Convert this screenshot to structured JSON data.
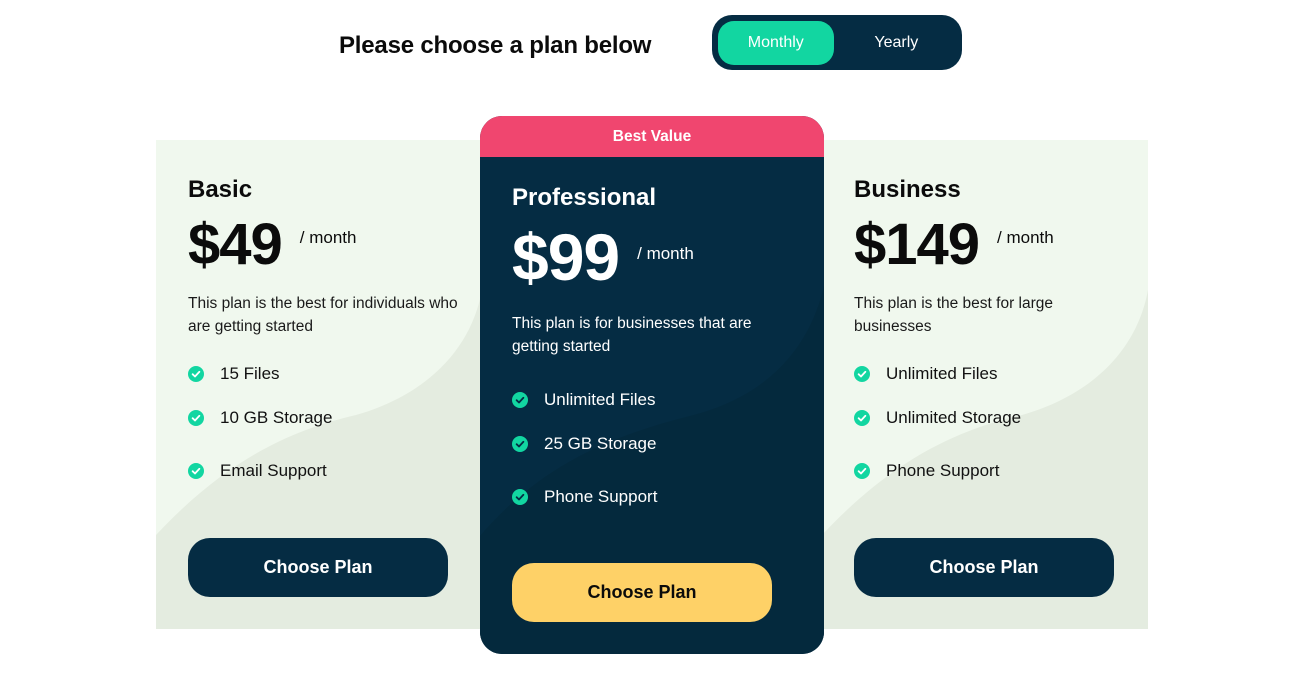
{
  "header": {
    "title": "Please choose a plan below",
    "toggle": {
      "monthly_label": "Monthly",
      "yearly_label": "Yearly",
      "selected": "Monthly"
    }
  },
  "colors": {
    "navy": "#052c43",
    "accent_green": "#12d6a1",
    "badge_pink": "#f0466f",
    "button_yellow": "#fed167",
    "panel_light": "#f0f8ee",
    "panel_wave": "#e4ece0"
  },
  "plans": [
    {
      "name": "Basic",
      "price": "$49",
      "period": "/ month",
      "description": "This plan is the best for individuals who are getting started",
      "features": [
        "15 Files",
        "10 GB Storage",
        "Email Support"
      ],
      "button": "Choose Plan"
    },
    {
      "badge": "Best Value",
      "name": "Professional",
      "price": "$99",
      "period": "/ month",
      "description": "This plan is for businesses that are getting started",
      "features": [
        "Unlimited Files",
        "25 GB Storage",
        "Phone Support"
      ],
      "button": "Choose Plan"
    },
    {
      "name": "Business",
      "price": "$149",
      "period": "/ month",
      "description": "This plan is the best for large businesses",
      "features": [
        "Unlimited Files",
        "Unlimited Storage",
        "Phone Support"
      ],
      "button": "Choose Plan"
    }
  ],
  "icons": {
    "feature": "check-circle-icon"
  }
}
